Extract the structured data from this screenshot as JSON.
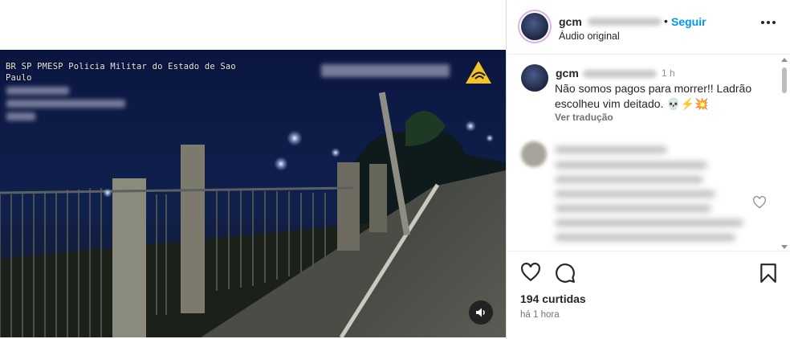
{
  "post": {
    "osd_line1": "BR SP PMESP Policia Militar do Estado de Sao",
    "osd_line2": "Paulo"
  },
  "header": {
    "username_visible": "gcm",
    "follow_label": "Seguir",
    "audio_label": "Áudio original"
  },
  "caption": {
    "username_visible": "gcm",
    "time": "1 h",
    "text": "Não somos pagos para morrer!! Ladrão escolheu vim deitado. 💀⚡💥",
    "translate_label": "Ver tradução"
  },
  "actions": {
    "likes": "194 curtidas",
    "posted_ago": "há 1 hora"
  },
  "icons": [
    "heart-icon",
    "comment-icon",
    "bookmark-icon",
    "more-options-icon",
    "volume-icon",
    "warning-logo-icon"
  ],
  "colors": {
    "link_blue": "#0095f6",
    "text_dark": "#262626",
    "muted": "#737373"
  }
}
